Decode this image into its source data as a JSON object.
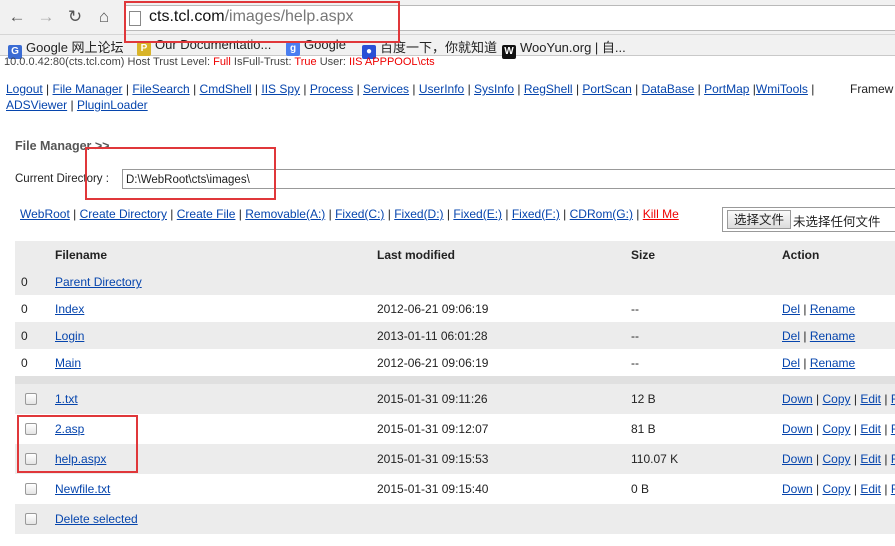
{
  "browser": {
    "url_host": "cts.tcl.com",
    "url_path": "/images/help.aspx",
    "bookmarks": [
      {
        "label": "Google 网上论坛",
        "icon": "google-groups-icon",
        "color": "#3b6cd4"
      },
      {
        "label": "Our Documentatio...",
        "icon": "python-icon",
        "color": "#d9b429"
      },
      {
        "label": "Google",
        "icon": "google-icon",
        "color": "#4a7ef0"
      },
      {
        "label": "百度一下，你就知道",
        "icon": "baidu-paw-icon",
        "color": "#2a4fd6"
      },
      {
        "label": "WooYun.org | 自...",
        "icon": "wooyun-icon",
        "color": "#111111"
      }
    ]
  },
  "info": {
    "prefix": "10.0.0.42:80(cts.tcl.com)  Host Trust Level:",
    "trust": "Full",
    "fulltrust_label": "IsFull-Trust:",
    "fulltrust": "True",
    "user_label": "User:",
    "user": "IIS APPPOOL\\cts"
  },
  "nav": {
    "links": [
      "Logout",
      "File Manager",
      "FileSearch",
      "CmdShell",
      "IIS Spy",
      "Process",
      "Services",
      "UserInfo",
      "SysInfo",
      "RegShell",
      "PortScan",
      "DataBase",
      "PortMap",
      "WmiTools",
      "ADSViewer",
      "PluginLoader"
    ],
    "trailing": "Framew"
  },
  "file_manager": {
    "title": "File Manager >>",
    "current_dir_label": "Current Directory :",
    "current_dir": "D:\\WebRoot\\cts\\images\\"
  },
  "drives": [
    {
      "label": "WebRoot"
    },
    {
      "label": "Create Directory"
    },
    {
      "label": "Create File"
    },
    {
      "label": "Removable(A:)"
    },
    {
      "label": "Fixed(C:)"
    },
    {
      "label": "Fixed(D:)"
    },
    {
      "label": "Fixed(E:)"
    },
    {
      "label": "Fixed(F:)"
    },
    {
      "label": "CDRom(G:)"
    },
    {
      "label": "Kill Me",
      "danger": true
    }
  ],
  "upload": {
    "button": "选择文件",
    "status": "未选择任何文件"
  },
  "table": {
    "headers": [
      "Filename",
      "Last modified",
      "Size",
      "Action"
    ],
    "parent": {
      "mark": "0",
      "name": "Parent Directory"
    },
    "dirs": [
      {
        "mark": "0",
        "name": "Index",
        "modified": "2012-06-21 09:06:19",
        "size": "--",
        "actions": [
          "Del",
          "Rename"
        ]
      },
      {
        "mark": "0",
        "name": "Login",
        "modified": "2013-01-11 06:01:28",
        "size": "--",
        "actions": [
          "Del",
          "Rename"
        ]
      },
      {
        "mark": "0",
        "name": "Main",
        "modified": "2012-06-21 09:06:19",
        "size": "--",
        "actions": [
          "Del",
          "Rename"
        ]
      }
    ],
    "files": [
      {
        "name": "1.txt",
        "modified": "2015-01-31 09:11:26",
        "size": "12 B",
        "actions": [
          "Down",
          "Copy",
          "Edit",
          "R"
        ]
      },
      {
        "name": "2.asp",
        "modified": "2015-01-31 09:12:07",
        "size": "81 B",
        "actions": [
          "Down",
          "Copy",
          "Edit",
          "R"
        ]
      },
      {
        "name": "help.aspx",
        "modified": "2015-01-31 09:15:53",
        "size": "110.07 K",
        "actions": [
          "Down",
          "Copy",
          "Edit",
          "R"
        ]
      },
      {
        "name": "Newfile.txt",
        "modified": "2015-01-31 09:15:40",
        "size": "0 B",
        "actions": [
          "Down",
          "Copy",
          "Edit",
          "R"
        ]
      }
    ],
    "delete_selected": "Delete selected"
  },
  "colors": {
    "annotation": "#e0373a",
    "link": "#0645ad",
    "danger": "#e00000"
  }
}
